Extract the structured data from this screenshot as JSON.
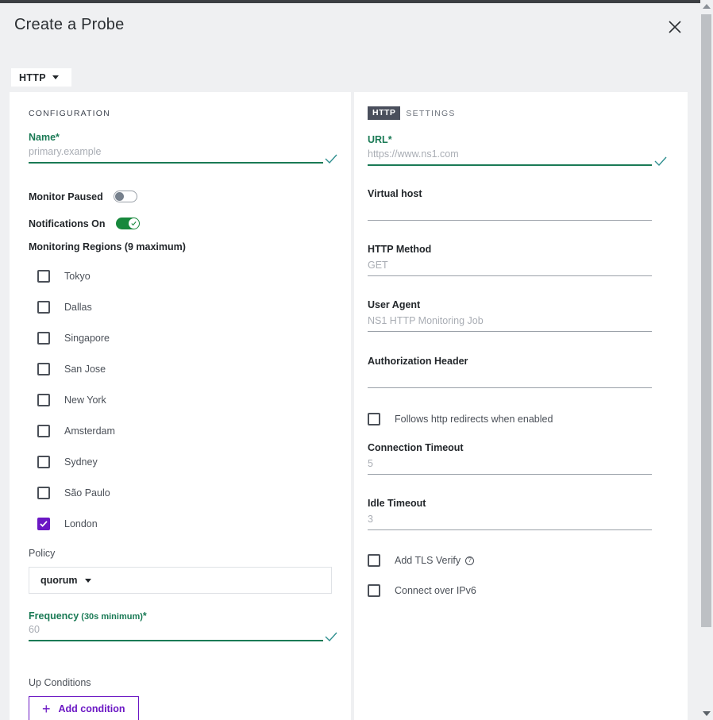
{
  "modal": {
    "title": "Create a Probe",
    "close_icon": "close-icon",
    "type_select": {
      "value": "HTTP",
      "caret_icon": "chevron-down-icon"
    }
  },
  "left_panel": {
    "section_label": "CONFIGURATION",
    "name_field": {
      "label": "Name",
      "required_marker": "*",
      "placeholder": "primary.example",
      "value": "",
      "valid_icon": "check-icon"
    },
    "monitor_paused": {
      "label": "Monitor Paused",
      "state": "off"
    },
    "notifications_on": {
      "label": "Notifications On",
      "state": "on"
    },
    "regions_label": "Monitoring Regions (9 maximum)",
    "regions": [
      {
        "label": "Tokyo",
        "checked": false
      },
      {
        "label": "Dallas",
        "checked": false
      },
      {
        "label": "Singapore",
        "checked": false
      },
      {
        "label": "San Jose",
        "checked": false
      },
      {
        "label": "New York",
        "checked": false
      },
      {
        "label": "Amsterdam",
        "checked": false
      },
      {
        "label": "Sydney",
        "checked": false
      },
      {
        "label": "São Paulo",
        "checked": false
      },
      {
        "label": "London",
        "checked": true
      }
    ],
    "policy": {
      "label": "Policy",
      "value": "quorum",
      "caret_icon": "chevron-down-icon"
    },
    "frequency": {
      "label": "Frequency",
      "sub_label": " (30s minimum)",
      "required_marker": "*",
      "placeholder": "60",
      "value": "",
      "valid_icon": "check-icon"
    },
    "up_conditions": {
      "label": "Up Conditions",
      "add_button": "Add condition",
      "add_icon": "plus-icon"
    }
  },
  "right_panel": {
    "badge": "HTTP",
    "badge_suffix": "SETTINGS",
    "url_field": {
      "label": "URL",
      "required_marker": "*",
      "placeholder": "https://www.ns1.com",
      "value": "",
      "valid_icon": "check-icon"
    },
    "virtual_host": {
      "label": "Virtual host",
      "placeholder": "",
      "value": ""
    },
    "http_method": {
      "label": "HTTP Method",
      "placeholder": "GET",
      "value": ""
    },
    "user_agent": {
      "label": "User Agent",
      "placeholder": "NS1 HTTP Monitoring Job",
      "value": ""
    },
    "authorization_header": {
      "label": "Authorization Header",
      "placeholder": "",
      "value": ""
    },
    "follow_redirects": {
      "label": "Follows http redirects when enabled",
      "checked": false
    },
    "connection_timeout": {
      "label": "Connection Timeout",
      "placeholder": "5",
      "value": ""
    },
    "idle_timeout": {
      "label": "Idle Timeout",
      "placeholder": "3",
      "value": ""
    },
    "add_tls_verify": {
      "label": "Add TLS Verify",
      "checked": false,
      "help_icon": "question-icon",
      "help_glyph": "?"
    },
    "connect_ipv6": {
      "label": "Connect over IPv6",
      "checked": false
    }
  },
  "scrollbar": {
    "up_icon": "caret-up-icon",
    "down_icon": "caret-down-icon"
  },
  "colors": {
    "accent_green": "#1a7a55",
    "accent_purple": "#6b17c4",
    "toggle_on": "#17883c",
    "badge_slate": "#4a4f5c",
    "page_bg": "#eff0f2"
  }
}
